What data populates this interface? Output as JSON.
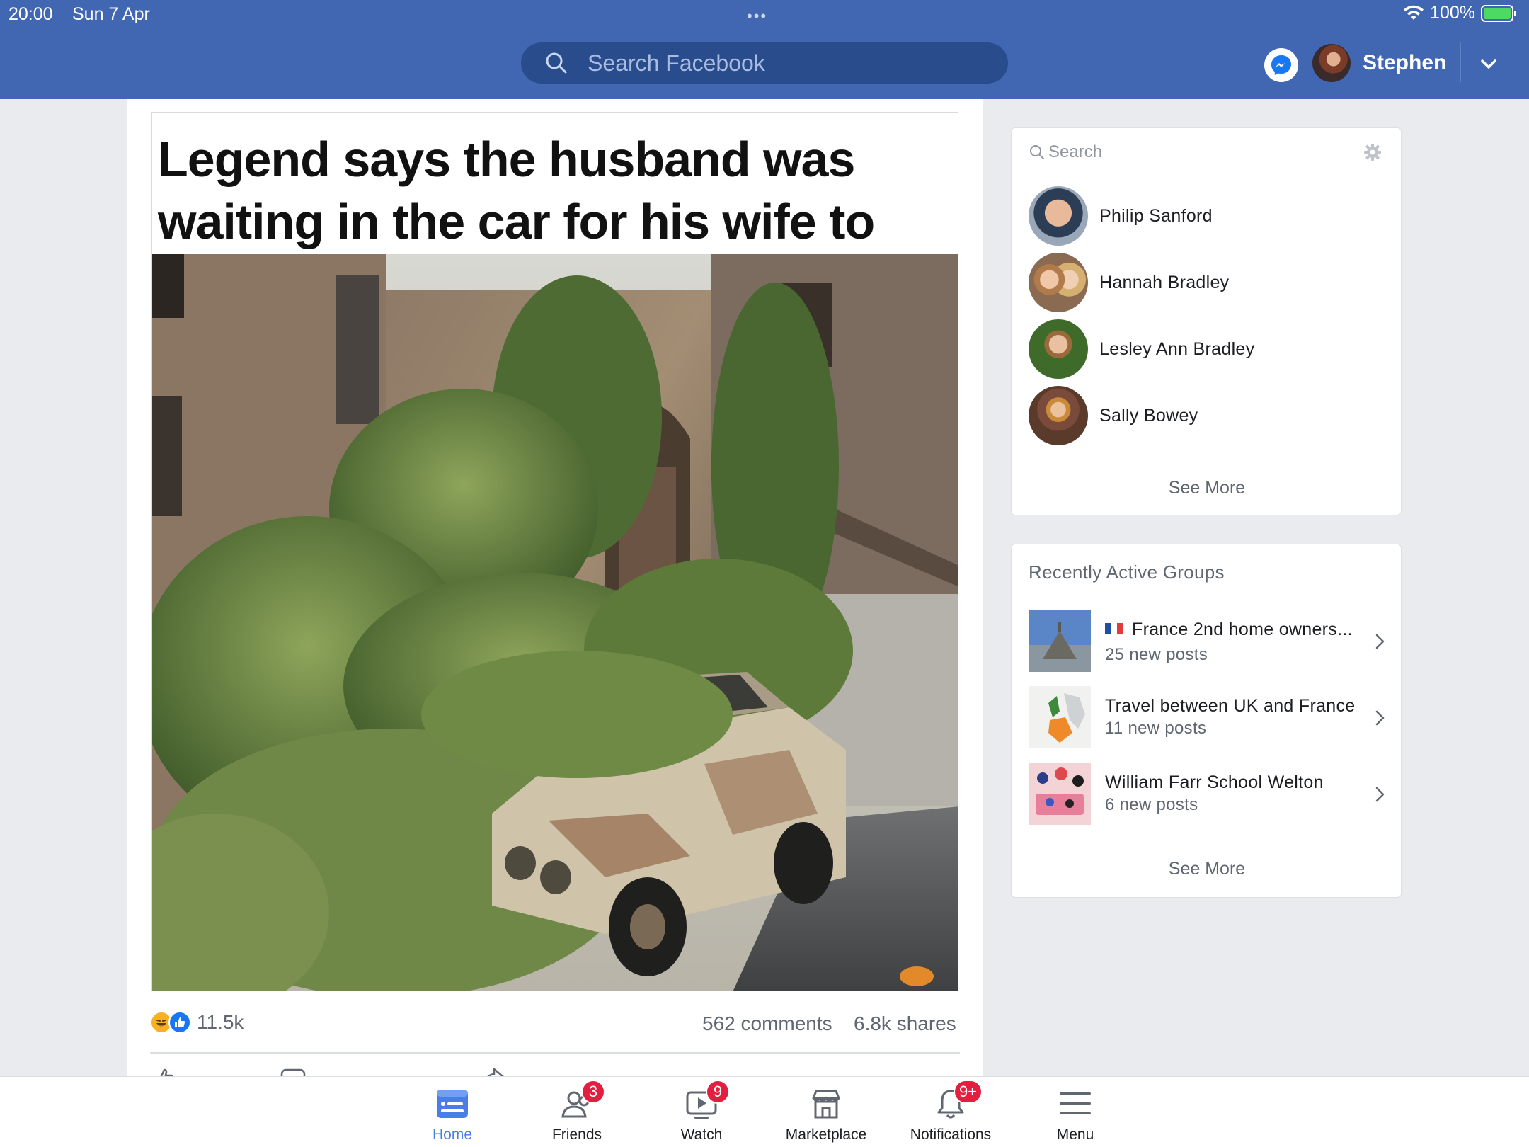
{
  "status_bar": {
    "time": "20:00",
    "date": "Sun 7 Apr",
    "dots": "•••",
    "battery": "100%"
  },
  "header": {
    "search_placeholder": "Search Facebook",
    "user_name": "Stephen"
  },
  "post": {
    "caption": "Legend says the husband was waiting in the car for his wife to get ready",
    "reactions_count": "11.5k",
    "comments": "562 comments",
    "shares": "6.8k shares"
  },
  "contacts": {
    "search_placeholder": "Search",
    "items": [
      {
        "name": "Philip Sanford"
      },
      {
        "name": "Hannah Bradley"
      },
      {
        "name": "Lesley Ann Bradley"
      },
      {
        "name": "Sally Bowey"
      }
    ],
    "see_more": "See More"
  },
  "groups": {
    "title": "Recently Active Groups",
    "items": [
      {
        "name": "France 2nd home owners...",
        "sub": "25 new posts"
      },
      {
        "name": "Travel between UK and France",
        "sub": "11 new posts"
      },
      {
        "name": "William Farr School Welton",
        "sub": "6 new posts"
      }
    ],
    "see_more": "See More"
  },
  "bottom_nav": {
    "items": [
      {
        "label": "Home",
        "icon": "home-feed-icon",
        "badge": ""
      },
      {
        "label": "Friends",
        "icon": "friends-icon",
        "badge": "3"
      },
      {
        "label": "Watch",
        "icon": "watch-icon",
        "badge": "9"
      },
      {
        "label": "Marketplace",
        "icon": "marketplace-icon",
        "badge": ""
      },
      {
        "label": "Notifications",
        "icon": "bell-icon",
        "badge": "9+"
      },
      {
        "label": "Menu",
        "icon": "menu-icon",
        "badge": ""
      }
    ]
  },
  "colors": {
    "header_blue": "#4167b2",
    "search_bg": "#294c8d",
    "badge_red": "#e41e3f",
    "active_tab": "#4a7ee6"
  }
}
